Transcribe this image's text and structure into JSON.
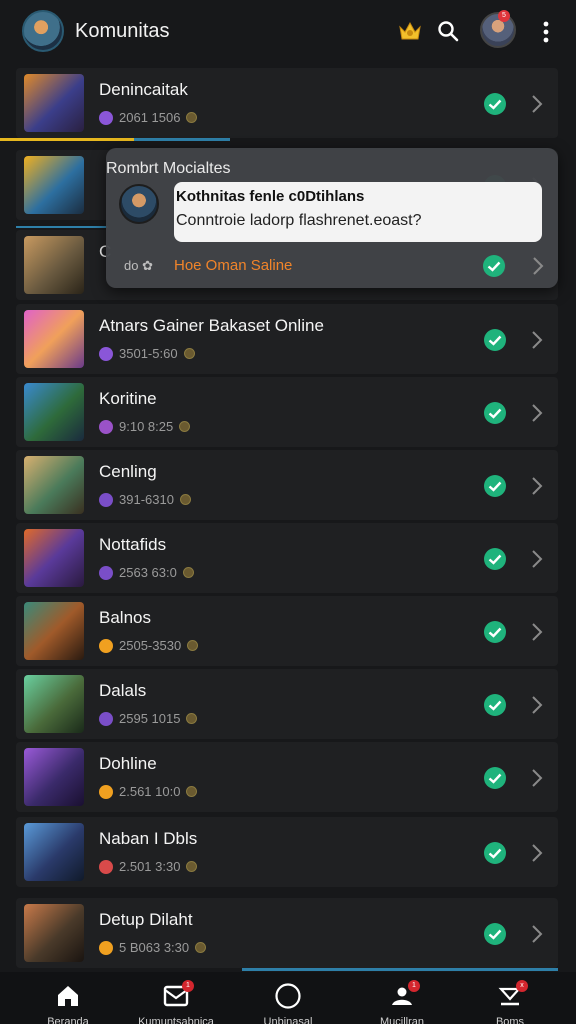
{
  "header": {
    "title": "Komunitas",
    "profile_badge": "5",
    "icons": [
      "app-avatar",
      "crown-icon",
      "search-icon",
      "profile-avatar",
      "kebab-menu-icon"
    ]
  },
  "colors": {
    "background": "#17181a",
    "row": "#1f2022",
    "accent_blue": "#2e7fa8",
    "accent_yellow": "#e6b71f",
    "check_green": "#1fb37c",
    "link_orange": "#f0842a"
  },
  "tooltip": {
    "title": "Rombrt Mocialtes",
    "line1": "Kothnitas fenle c0Dtihlans",
    "line2": "Conntroie ladorp flashrenet.eoast?",
    "link": "Hoe Oman Saline",
    "behind_meta": "do"
  },
  "rows": [
    {
      "name": "Denincaitak",
      "meta": "2061 1506",
      "dot": "#8a56d8"
    },
    {
      "name": "",
      "meta": "",
      "dot": "#8a56d8"
    },
    {
      "name": "C",
      "meta": "",
      "dot": "#8a56d8"
    },
    {
      "name": "Atnars Gainer Bakaset Online",
      "meta": "3501-5:60",
      "dot": "#8a56d8"
    },
    {
      "name": "Koritine",
      "meta": "9:10 8:25",
      "dot": "#9a52c8"
    },
    {
      "name": "Cenling",
      "meta": "391-6310",
      "dot": "#7a4ec8"
    },
    {
      "name": "Nottafids",
      "meta": "2563 63:0",
      "dot": "#7a4ec8"
    },
    {
      "name": "Balnos",
      "meta": "2505-3530",
      "dot": "#f0a020"
    },
    {
      "name": "Dalals",
      "meta": "2595 1015",
      "dot": "#7a4ec8"
    },
    {
      "name": "Dohline",
      "meta": "2.561 10:0",
      "dot": "#f0a020"
    },
    {
      "name": "Naban I Dbls",
      "meta": "2.501 3:30",
      "dot": "#d84a4a"
    },
    {
      "name": "Detup Dilaht",
      "meta": "5 B063 3:30",
      "dot": "#f0a020"
    }
  ],
  "bottom_nav": [
    {
      "label": "Beranda",
      "icon": "home-icon",
      "badge": ""
    },
    {
      "label": "Kumuntsabnica",
      "icon": "inbox-icon",
      "badge": "1"
    },
    {
      "label": "Unbinasal",
      "icon": "circle-icon",
      "badge": ""
    },
    {
      "label": "Mucillran",
      "icon": "community-icon",
      "badge": "1"
    },
    {
      "label": "Boms",
      "icon": "download-icon",
      "badge": "x"
    }
  ]
}
